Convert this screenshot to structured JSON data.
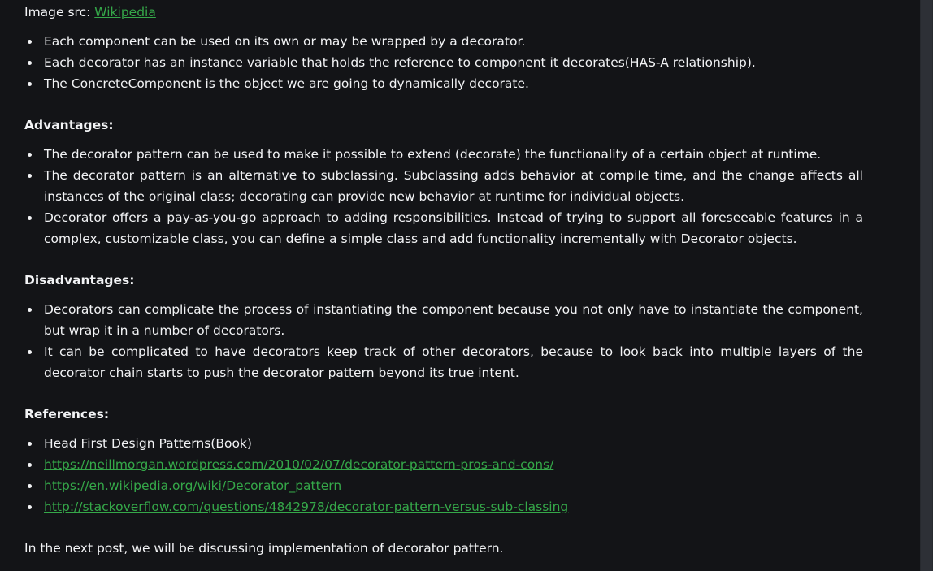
{
  "image_src": {
    "prefix": "Image src: ",
    "link_text": "Wikipedia"
  },
  "component_points": [
    "Each component can be used on its own or may be wrapped by a decorator.",
    "Each decorator has an instance variable that holds the reference to component it decorates(HAS-A relationship).",
    "The ConcreteComponent is the object we are going to dynamically decorate."
  ],
  "advantages": {
    "heading": "Advantages:",
    "items": [
      "The decorator pattern can be used to make it possible to extend (decorate) the functionality of a certain object at runtime.",
      "The decorator pattern is an alternative to subclassing. Subclassing adds behavior at compile time, and the change affects all instances of the original class; decorating can provide new behavior at runtime for individual objects.",
      "Decorator offers a pay-as-you-go approach to adding responsibilities. Instead of trying to support all foreseeable features in a complex, customizable class, you can define a simple class and add functionality incrementally with Decorator objects."
    ]
  },
  "disadvantages": {
    "heading": "Disadvantages:",
    "items": [
      "Decorators can complicate the process of instantiating the component because you not only have to instantiate the component, but wrap it in a number of decorators.",
      "It can be complicated to have decorators keep track of other decorators, because to look back into multiple layers of the decorator chain starts to push the decorator pattern beyond its true intent."
    ]
  },
  "references": {
    "heading": "References:",
    "book": "Head First Design Patterns(Book)",
    "links": [
      "https://neillmorgan.wordpress.com/2010/02/07/decorator-pattern-pros-and-cons/",
      "https://en.wikipedia.org/wiki/Decorator_pattern",
      "http://stackoverflow.com/questions/4842978/decorator-pattern-versus-sub-classing"
    ]
  },
  "closing": "In the next post, we will be discussing implementation of decorator pattern.",
  "colors": {
    "background": "#131417",
    "text": "#f2f3f5",
    "link": "#35a849",
    "scrollbar": "#2d3036"
  }
}
